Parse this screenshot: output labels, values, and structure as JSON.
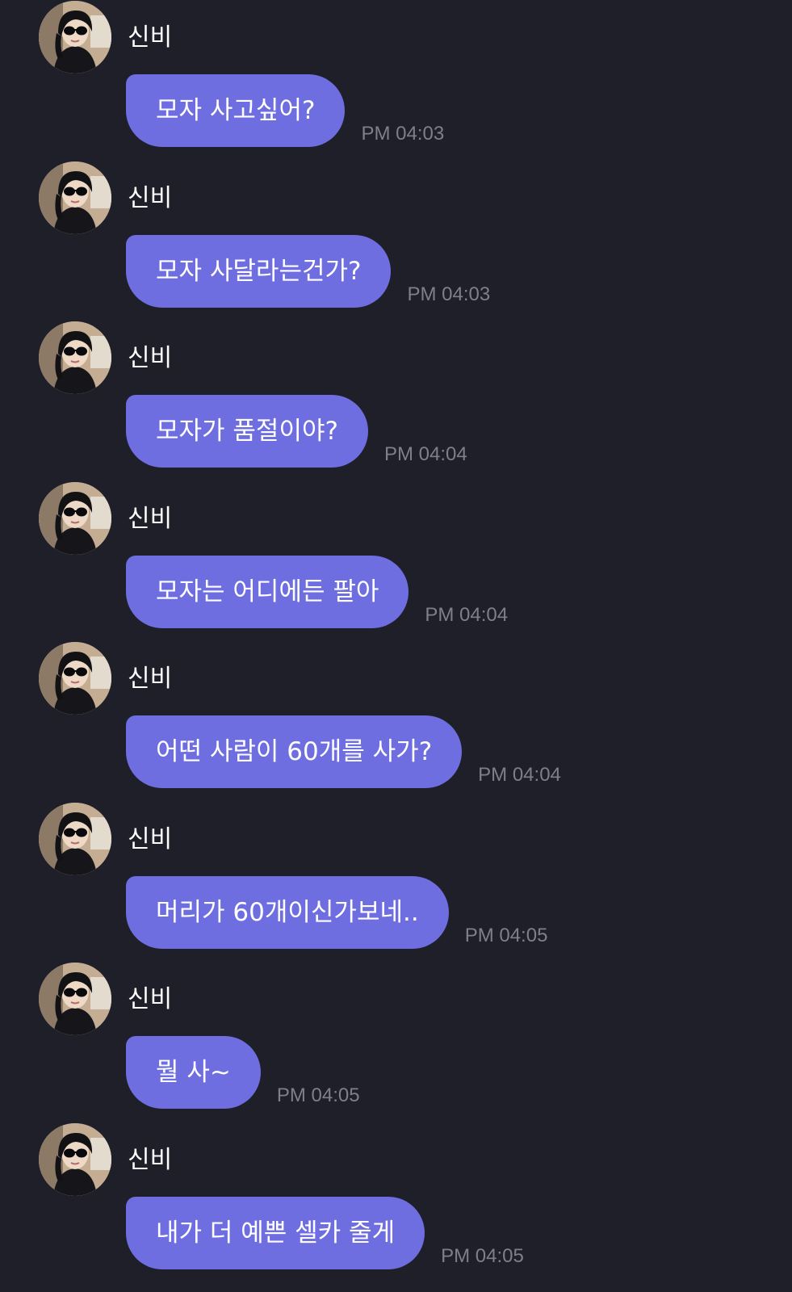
{
  "colors": {
    "background": "#1f1f29",
    "bubble": "#6f6ee0",
    "bubble_text": "#ffffff",
    "sender_text": "#ffffff",
    "timestamp_text": "#7f7f8c"
  },
  "avatar_icon": "profile-photo-woman-sunglasses",
  "messages": [
    {
      "sender": "신비",
      "text": "모자 사고싶어?",
      "time": "PM 04:03"
    },
    {
      "sender": "신비",
      "text": "모자 사달라는건가?",
      "time": "PM 04:03"
    },
    {
      "sender": "신비",
      "text": "모자가 품절이야?",
      "time": "PM 04:04"
    },
    {
      "sender": "신비",
      "text": "모자는 어디에든 팔아",
      "time": "PM 04:04"
    },
    {
      "sender": "신비",
      "text": "어떤 사람이 60개를 사가?",
      "time": "PM 04:04"
    },
    {
      "sender": "신비",
      "text": "머리가 60개이신가보네..",
      "time": "PM 04:05"
    },
    {
      "sender": "신비",
      "text": "뭘 사~",
      "time": "PM 04:05"
    },
    {
      "sender": "신비",
      "text": "내가 더 예쁜 셀카 줄게",
      "time": "PM 04:05"
    }
  ]
}
